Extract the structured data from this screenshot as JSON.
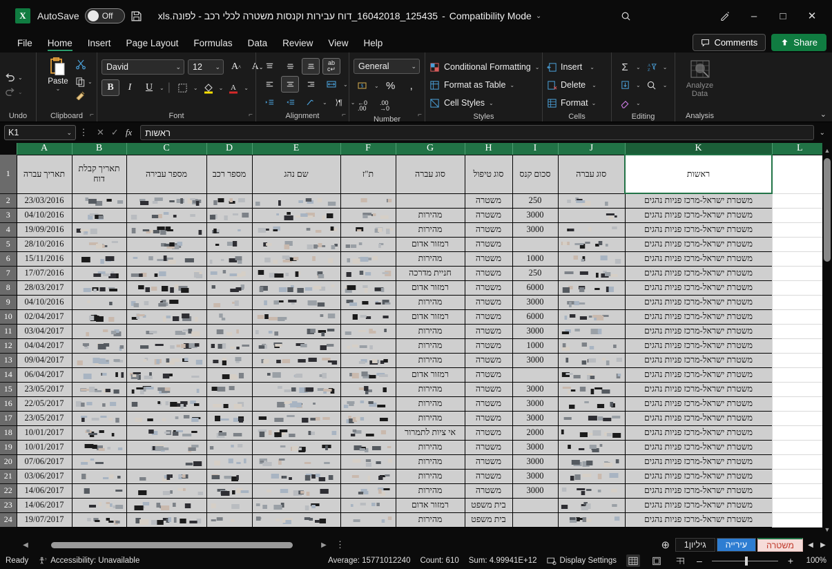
{
  "titlebar": {
    "app_icon": "excel-logo",
    "autosave_label": "AutoSave",
    "autosave_state": "Off",
    "save_icon": "save-icon",
    "document_title": "125435_16042018_דוח עבירות וקנסות משטרה לכלי רכב - לפונה.xls",
    "separator": "-",
    "compatibility": "Compatibility Mode",
    "search_icon": "search-icon",
    "draw_icon": "pen-icon",
    "minimize": "–",
    "maximize": "□",
    "close": "✕"
  },
  "ribbon": {
    "tabs": [
      {
        "label": "File",
        "active": false
      },
      {
        "label": "Home",
        "active": true
      },
      {
        "label": "Insert",
        "active": false
      },
      {
        "label": "Page Layout",
        "active": false
      },
      {
        "label": "Formulas",
        "active": false
      },
      {
        "label": "Data",
        "active": false
      },
      {
        "label": "Review",
        "active": false
      },
      {
        "label": "View",
        "active": false
      },
      {
        "label": "Help",
        "active": false
      }
    ],
    "comments_label": "Comments",
    "share_label": "Share",
    "groups": {
      "undo": "Undo",
      "clipboard": "Clipboard",
      "paste_label": "Paste",
      "font": "Font",
      "alignment": "Alignment",
      "number": "Number",
      "styles": "Styles",
      "cells": "Cells",
      "editing": "Editing",
      "analysis": "Analysis"
    },
    "font_name": "David",
    "font_size": "12",
    "number_format": "General",
    "styles_items": [
      "Conditional Formatting",
      "Format as Table",
      "Cell Styles"
    ],
    "cells_items": [
      "Insert",
      "Delete",
      "Format"
    ],
    "analyze_line1": "Analyze",
    "analyze_line2": "Data",
    "collapse_icon": "chevron-down-icon"
  },
  "formulabar": {
    "name_box": "K1",
    "cancel_icon": "cancel-icon",
    "confirm_icon": "confirm-icon",
    "fx_label": "fx",
    "value": "ראשות",
    "expand_icon": "chevron-down-icon"
  },
  "grid": {
    "column_headers": [
      "L",
      "K",
      "J",
      "I",
      "H",
      "G",
      "F",
      "E",
      "D",
      "C",
      "B",
      "A"
    ],
    "selected_column": "K",
    "row_numbers": [
      "1",
      "2",
      "3",
      "4",
      "5",
      "6",
      "7",
      "8",
      "9",
      "10",
      "11",
      "12",
      "13",
      "14",
      "15",
      "16",
      "17",
      "18",
      "19",
      "20",
      "21",
      "22",
      "23",
      "24"
    ],
    "header_row": {
      "L": "",
      "K": "ראשות",
      "J": "סוג עברה",
      "I": "סכום קנס",
      "H": "סוג טיפול",
      "G": "סוג עברה",
      "F": "ת\"ז",
      "E": "שם נהג",
      "D": "מספר רכב",
      "C": "מספר עבירה",
      "B": "תאריך קבלת דוח",
      "A": "תאריך עברה"
    },
    "authority_value": "משטרת ישראל-מרכז פניות נהגים",
    "rows": [
      {
        "row": "2",
        "A": "23/03/2016",
        "G": "",
        "H": "משטרה",
        "I": "250",
        "J": "redacted"
      },
      {
        "row": "3",
        "A": "04/10/2016",
        "G": "מהירות",
        "H": "משטרה",
        "I": "3000",
        "J": "redacted"
      },
      {
        "row": "4",
        "A": "19/09/2016",
        "G": "מהירות",
        "H": "משטרה",
        "I": "3000",
        "J": "redacted"
      },
      {
        "row": "5",
        "A": "28/10/2016",
        "G": "רמזור אדום",
        "H": "משטרה",
        "I": "",
        "J": "redacted"
      },
      {
        "row": "6",
        "A": "15/11/2016",
        "G": "מהירות",
        "H": "משטרה",
        "I": "1000",
        "J": "redacted"
      },
      {
        "row": "7",
        "A": "17/07/2016",
        "G": "חניית מדרכה",
        "H": "משטרה",
        "I": "250",
        "J": "redacted"
      },
      {
        "row": "8",
        "A": "28/03/2017",
        "G": "רמזור אדום",
        "H": "משטרה",
        "I": "6000",
        "J": "redacted"
      },
      {
        "row": "9",
        "A": "04/10/2016",
        "G": "מהירות",
        "H": "משטרה",
        "I": "3000",
        "J": "redacted"
      },
      {
        "row": "10",
        "A": "02/04/2017",
        "G": "רמזור אדום",
        "H": "משטרה",
        "I": "6000",
        "J": "redacted"
      },
      {
        "row": "11",
        "A": "03/04/2017",
        "G": "מהירות",
        "H": "משטרה",
        "I": "3000",
        "J": "redacted"
      },
      {
        "row": "12",
        "A": "04/04/2017",
        "G": "מהירות",
        "H": "משטרה",
        "I": "1000",
        "J": "redacted"
      },
      {
        "row": "13",
        "A": "09/04/2017",
        "G": "מהירות",
        "H": "משטרה",
        "I": "3000",
        "J": "redacted"
      },
      {
        "row": "14",
        "A": "06/04/2017",
        "G": "רמזור אדום",
        "H": "משטרה",
        "I": "",
        "J": "redacted"
      },
      {
        "row": "15",
        "A": "23/05/2017",
        "G": "מהירות",
        "H": "משטרה",
        "I": "3000",
        "J": "redacted"
      },
      {
        "row": "16",
        "A": "22/05/2017",
        "G": "מהירות",
        "H": "משטרה",
        "I": "3000",
        "J": "redacted"
      },
      {
        "row": "17",
        "A": "23/05/2017",
        "G": "מהירות",
        "H": "משטרה",
        "I": "3000",
        "J": "redacted"
      },
      {
        "row": "18",
        "A": "10/01/2017",
        "G": "אי ציות לתמרור",
        "H": "משטרה",
        "I": "2000",
        "J": "redacted"
      },
      {
        "row": "19",
        "A": "10/01/2017",
        "G": "מהירות",
        "H": "משטרה",
        "I": "3000",
        "J": "redacted"
      },
      {
        "row": "20",
        "A": "07/06/2017",
        "G": "מהירות",
        "H": "משטרה",
        "I": "3000",
        "J": "redacted"
      },
      {
        "row": "21",
        "A": "03/06/2017",
        "G": "מהירות",
        "H": "משטרה",
        "I": "3000",
        "J": "redacted"
      },
      {
        "row": "22",
        "A": "14/06/2017",
        "G": "מהירות",
        "H": "משטרה",
        "I": "3000",
        "J": "redacted"
      },
      {
        "row": "23",
        "A": "14/06/2017",
        "G": "רמזור אדום",
        "H": "בית משפט",
        "I": "",
        "J": "redacted"
      },
      {
        "row": "24",
        "A": "19/07/2017",
        "G": "מהירות",
        "H": "בית משפט",
        "I": "",
        "J": "redacted"
      }
    ]
  },
  "sheettabs": {
    "add_label": "+",
    "prev_icon": "chevron-left-icon",
    "next_icon": "chevron-right-icon",
    "tabs": [
      {
        "label": "גיליון1",
        "state": "plain"
      },
      {
        "label": "עירייה",
        "state": "city"
      },
      {
        "label": "משטרה",
        "state": "active"
      }
    ]
  },
  "statusbar": {
    "mode": "Ready",
    "accessibility": "Accessibility: Unavailable",
    "average": "Average: 15771012240",
    "count": "Count: 610",
    "sum": "Sum: 4.99941E+12",
    "display_settings": "Display Settings",
    "zoom": "100%",
    "zoom_out": "–",
    "zoom_in": "+"
  }
}
